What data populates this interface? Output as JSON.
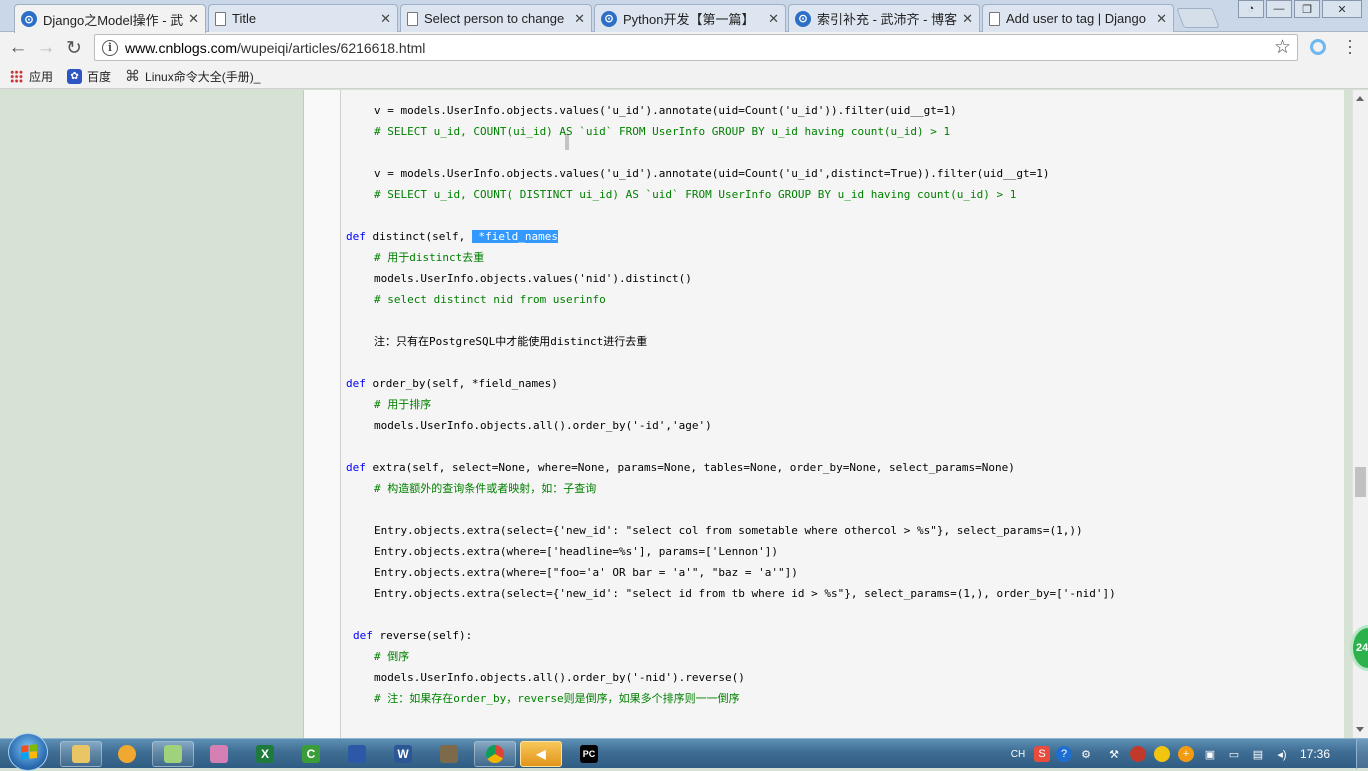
{
  "tabs": [
    {
      "title": "Django之Model操作 - 武沛齐",
      "icon": "blog-icon",
      "active": true
    },
    {
      "title": "Title",
      "icon": "page-icon",
      "active": false
    },
    {
      "title": "Select person to change",
      "icon": "page-icon",
      "active": false
    },
    {
      "title": "Python开发【第一篇】",
      "icon": "blog-icon",
      "active": false
    },
    {
      "title": "索引补充 - 武沛齐 - 博客",
      "icon": "blog-icon",
      "active": false
    },
    {
      "title": "Add user to tag | Django",
      "icon": "page-icon",
      "active": false
    }
  ],
  "address_bar": {
    "url_host": "www.cnblogs.com",
    "url_path": "/wupeiqi/articles/6216618.html"
  },
  "bookmarks": [
    {
      "label": "应用",
      "icon": "apps-grid-icon"
    },
    {
      "label": "百度",
      "icon": "baidu-paw-icon"
    },
    {
      "label": "Linux命令大全(手册)_",
      "icon": "command-icon"
    }
  ],
  "code": {
    "line01": "v = models.UserInfo.objects.values('u_id').annotate(uid=Count('u_id')).filter(uid__gt=1)",
    "line02": "# SELECT u_id, COUNT(ui_id) AS `uid` FROM UserInfo GROUP BY u_id having count(u_id) > 1",
    "line03": "v = models.UserInfo.objects.values('u_id').annotate(uid=Count('u_id',distinct=True)).filter(uid__gt=1)",
    "line04": "# SELECT u_id, COUNT( DISTINCT ui_id) AS `uid` FROM UserInfo GROUP BY u_id having count(u_id) > 1",
    "line05_kw": "def",
    "line05_pre": " distinct(self, ",
    "line05_hl": " *field_names",
    "line06": "# 用于distinct去重",
    "line07": "models.UserInfo.objects.values('nid').distinct()",
    "line08": "# select distinct nid from userinfo",
    "line09": "注：只有在PostgreSQL中才能使用distinct进行去重",
    "line10_kw": "def",
    "line10_rest": " order_by(self, *field_names)",
    "line11": "# 用于排序",
    "line12": "models.UserInfo.objects.all().order_by('-id','age')",
    "line13_kw": "def",
    "line13_rest": " extra(self, select=None, where=None, params=None, tables=None, order_by=None, select_params=None)",
    "line14": "# 构造额外的查询条件或者映射，如：子查询",
    "line15": "Entry.objects.extra(select={'new_id': \"select col from sometable where othercol > %s\"}, select_params=(1,))",
    "line16": "Entry.objects.extra(where=['headline=%s'], params=['Lennon'])",
    "line17": "Entry.objects.extra(where=[\"foo='a' OR bar = 'a'\", \"baz = 'a'\"])",
    "line18": "Entry.objects.extra(select={'new_id': \"select id from tb where id > %s\"}, select_params=(1,), order_by=['-nid'])",
    "line19_kw": "def",
    "line19_rest": " reverse(self):",
    "line20": "# 倒序",
    "line21": "models.UserInfo.objects.all().order_by('-nid').reverse()",
    "line22": "# 注：如果存在order_by，reverse则是倒序，如果多个排序则一一倒序"
  },
  "float_badge": "24",
  "tray": {
    "lang": "CH",
    "clock": "17:36"
  },
  "colors": {
    "keyword": "#0000ff",
    "comment": "#008000",
    "selection": "#3399ff",
    "page_bg": "#d6e2d3"
  }
}
